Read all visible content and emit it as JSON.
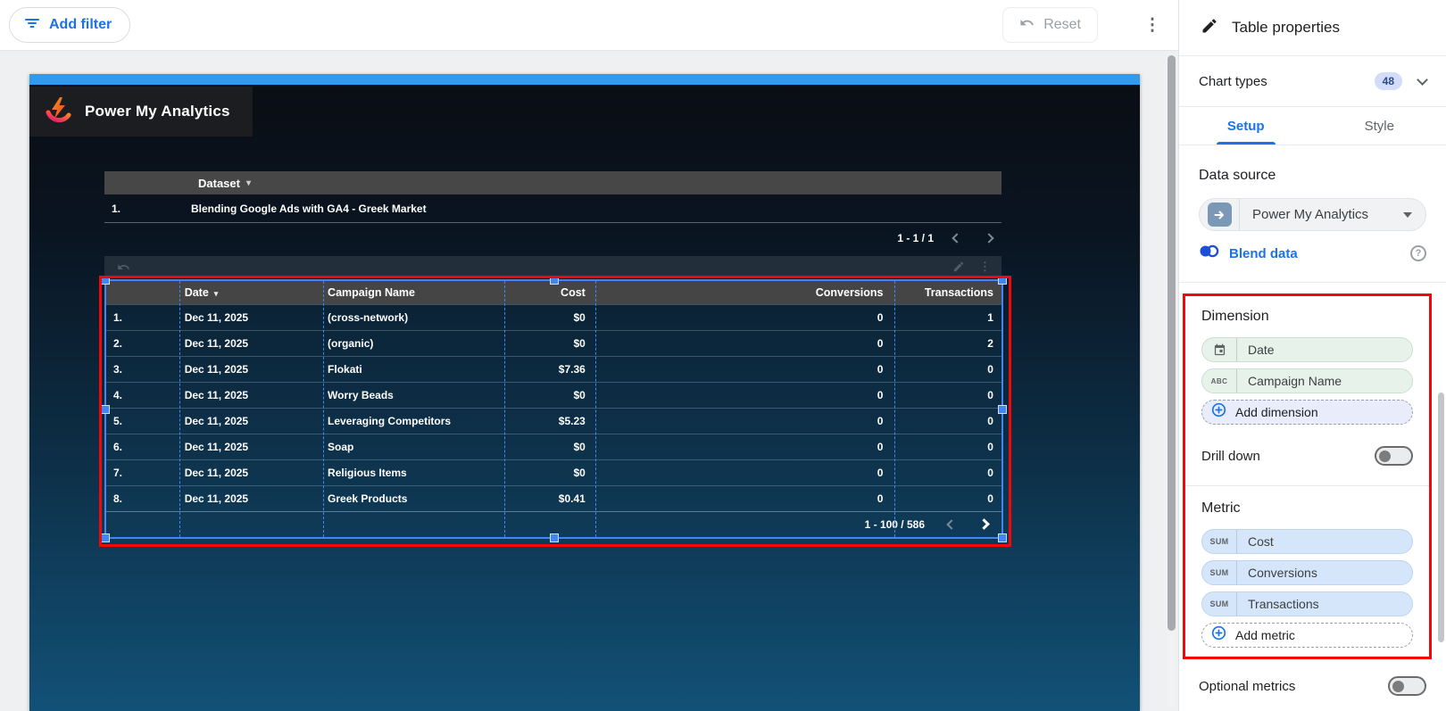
{
  "topbar": {
    "add_filter_label": "Add filter",
    "reset_label": "Reset"
  },
  "canvas": {
    "logo_text": "Power My Analytics",
    "dataset_table": {
      "header_label": "Dataset",
      "rows": [
        {
          "index": "1.",
          "name": "Blending Google Ads with GA4 - Greek Market"
        }
      ],
      "pagination": "1 - 1 / 1"
    },
    "data_table": {
      "columns": [
        "Date",
        "Campaign Name",
        "Cost",
        "Conversions",
        "Transactions"
      ],
      "rows": [
        {
          "index": "1.",
          "date": "Dec 11, 2025",
          "campaign": "(cross-network)",
          "cost": "$0",
          "conversions": "0",
          "transactions": "1"
        },
        {
          "index": "2.",
          "date": "Dec 11, 2025",
          "campaign": "(organic)",
          "cost": "$0",
          "conversions": "0",
          "transactions": "2"
        },
        {
          "index": "3.",
          "date": "Dec 11, 2025",
          "campaign": "Flokati",
          "cost": "$7.36",
          "conversions": "0",
          "transactions": "0"
        },
        {
          "index": "4.",
          "date": "Dec 11, 2025",
          "campaign": "Worry Beads",
          "cost": "$0",
          "conversions": "0",
          "transactions": "0"
        },
        {
          "index": "5.",
          "date": "Dec 11, 2025",
          "campaign": "Leveraging Competitors",
          "cost": "$5.23",
          "conversions": "0",
          "transactions": "0"
        },
        {
          "index": "6.",
          "date": "Dec 11, 2025",
          "campaign": "Soap",
          "cost": "$0",
          "conversions": "0",
          "transactions": "0"
        },
        {
          "index": "7.",
          "date": "Dec 11, 2025",
          "campaign": "Religious Items",
          "cost": "$0",
          "conversions": "0",
          "transactions": "0"
        },
        {
          "index": "8.",
          "date": "Dec 11, 2025",
          "campaign": "Greek Products",
          "cost": "$0.41",
          "conversions": "0",
          "transactions": "0"
        }
      ],
      "pagination": "1 - 100 / 586"
    }
  },
  "panel": {
    "title": "Table properties",
    "chart_types": {
      "label": "Chart types",
      "count": "48"
    },
    "tabs": [
      {
        "label": "Setup",
        "active": true
      },
      {
        "label": "Style",
        "active": false
      }
    ],
    "data_source": {
      "heading": "Data source",
      "name": "Power My Analytics",
      "blend_label": "Blend data"
    },
    "dimension": {
      "heading": "Dimension",
      "fields": [
        {
          "kind": "date",
          "label": "Date"
        },
        {
          "kind": "text",
          "label": "Campaign Name"
        }
      ],
      "add_label": "Add dimension",
      "drilldown_label": "Drill down"
    },
    "metric": {
      "heading": "Metric",
      "fields": [
        {
          "agg": "SUM",
          "label": "Cost"
        },
        {
          "agg": "SUM",
          "label": "Conversions"
        },
        {
          "agg": "SUM",
          "label": "Transactions"
        }
      ],
      "add_label": "Add metric",
      "optional_label": "Optional metrics"
    }
  },
  "colors": {
    "accent_blue": "#1a73e8",
    "selection_blue": "#4285f4",
    "annotation_red": "#f20808",
    "canvas_top_bar": "#2e9bf0",
    "table_header_gray": "#474747",
    "dimension_pill_green": "#e7f3ea",
    "metric_pill_blue": "#d5e5fa"
  }
}
